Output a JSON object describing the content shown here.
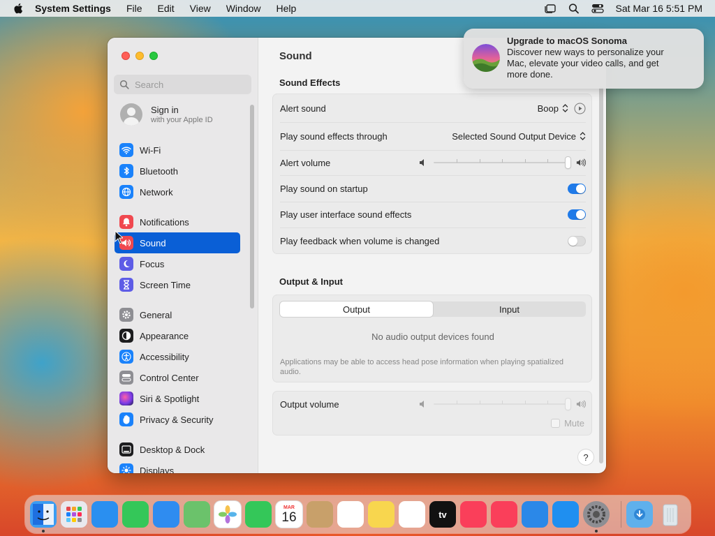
{
  "menubar": {
    "app_name": "System Settings",
    "items": [
      "File",
      "Edit",
      "View",
      "Window",
      "Help"
    ],
    "clock": "Sat Mar 16  5:51 PM"
  },
  "sidebar": {
    "search_placeholder": "Search",
    "signin": {
      "title": "Sign in",
      "subtitle": "with your Apple ID"
    },
    "items": [
      {
        "label": "Wi-Fi",
        "icon": "wifi-icon",
        "color": "#1a82fb"
      },
      {
        "label": "Bluetooth",
        "icon": "bluetooth-icon",
        "color": "#1a82fb"
      },
      {
        "label": "Network",
        "icon": "globe-icon",
        "color": "#1a82fb"
      },
      {
        "label": "Notifications",
        "icon": "bell-icon",
        "color": "#f0484f"
      },
      {
        "label": "Sound",
        "icon": "speaker-icon",
        "color": "#f0484f"
      },
      {
        "label": "Focus",
        "icon": "moon-icon",
        "color": "#5e5ce6"
      },
      {
        "label": "Screen Time",
        "icon": "hourglass-icon",
        "color": "#5e5ce6"
      },
      {
        "label": "General",
        "icon": "gear-icon",
        "color": "#8e8e93"
      },
      {
        "label": "Appearance",
        "icon": "appearance-icon",
        "color": "#1c1c1e"
      },
      {
        "label": "Accessibility",
        "icon": "accessibility-icon",
        "color": "#1a82fb"
      },
      {
        "label": "Control Center",
        "icon": "control-center-icon",
        "color": "#8e8e93"
      },
      {
        "label": "Siri & Spotlight",
        "icon": "siri-icon",
        "color": "#b03fd0"
      },
      {
        "label": "Privacy & Security",
        "icon": "hand-icon",
        "color": "#1a82fb"
      },
      {
        "label": "Desktop & Dock",
        "icon": "dock-icon",
        "color": "#1c1c1e"
      },
      {
        "label": "Displays",
        "icon": "sun-icon",
        "color": "#1a82fb"
      }
    ],
    "selected": "Sound"
  },
  "content": {
    "title": "Sound",
    "sound_effects": {
      "heading": "Sound Effects",
      "alert_sound_label": "Alert sound",
      "alert_sound_value": "Boop",
      "play_through_label": "Play sound effects through",
      "play_through_value": "Selected Sound Output Device",
      "alert_volume_label": "Alert volume",
      "alert_volume_level": 1.0,
      "startup_label": "Play sound on startup",
      "startup_on": true,
      "ui_sounds_label": "Play user interface sound effects",
      "ui_sounds_on": true,
      "feedback_label": "Play feedback when volume is changed",
      "feedback_on": false
    },
    "output_input": {
      "heading": "Output & Input",
      "tabs": [
        "Output",
        "Input"
      ],
      "active_tab": "Output",
      "empty_message": "No audio output devices found",
      "note": "Applications may be able to access head pose information when playing spatialized audio."
    },
    "output_volume": {
      "label": "Output volume",
      "level": 1.0,
      "mute_label": "Mute"
    },
    "help_label": "?"
  },
  "notification": {
    "title": "Upgrade to macOS Sonoma",
    "body": "Discover new ways to personalize your Mac, elevate your video calls, and get more done."
  },
  "dock": {
    "calendar_month": "MAR",
    "calendar_day": "16",
    "tv_label": "tv",
    "apps": [
      {
        "name": "finder",
        "color": "#3b9cf2",
        "running": true
      },
      {
        "name": "launchpad",
        "color": "#e9e9ee",
        "running": false
      },
      {
        "name": "safari",
        "color": "#2a8ff0",
        "running": false
      },
      {
        "name": "messages",
        "color": "#34c759",
        "running": false
      },
      {
        "name": "mail",
        "color": "#2f8cf0",
        "running": false
      },
      {
        "name": "maps",
        "color": "#6bc26b",
        "running": false
      },
      {
        "name": "photos",
        "color": "#ffffff",
        "running": false
      },
      {
        "name": "facetime",
        "color": "#34c759",
        "running": false
      },
      {
        "name": "calendar",
        "color": "#ffffff",
        "running": false
      },
      {
        "name": "contacts",
        "color": "#c8a06a",
        "running": false
      },
      {
        "name": "reminders",
        "color": "#ffffff",
        "running": false
      },
      {
        "name": "notes",
        "color": "#f8d64e",
        "running": false
      },
      {
        "name": "freeform",
        "color": "#ffffff",
        "running": false
      },
      {
        "name": "tv",
        "color": "#111111",
        "running": false
      },
      {
        "name": "music",
        "color": "#fa3f5a",
        "running": false
      },
      {
        "name": "news",
        "color": "#fa3f5a",
        "running": false
      },
      {
        "name": "keynote",
        "color": "#2b88e8",
        "running": false
      },
      {
        "name": "app-store",
        "color": "#1f8ff0",
        "running": false
      },
      {
        "name": "system-settings",
        "color": "#8e8e93",
        "running": true
      },
      {
        "name": "downloads",
        "color": "#5fb0ec",
        "running": false
      },
      {
        "name": "trash",
        "color": "#d9e3ea",
        "running": false
      }
    ]
  }
}
